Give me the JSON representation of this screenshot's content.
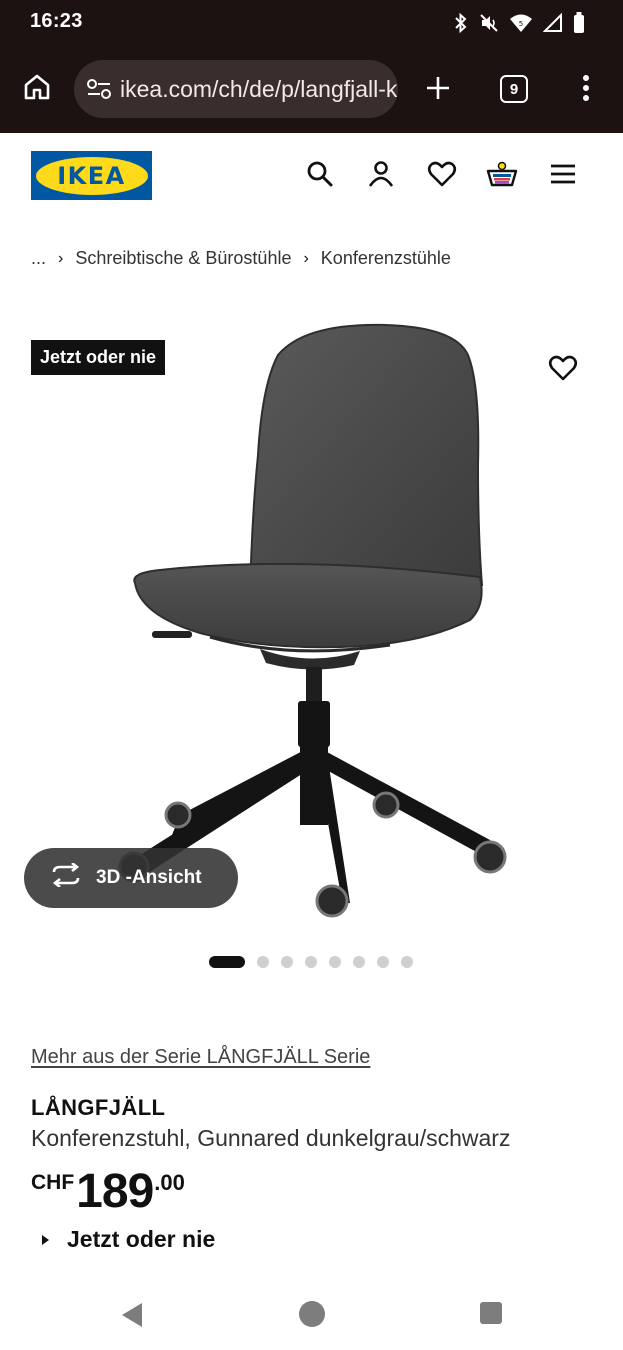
{
  "status_bar": {
    "time": "16:23",
    "icons": [
      "bluetooth-icon",
      "mute-icon",
      "wifi-icon",
      "signal-icon",
      "battery-icon"
    ]
  },
  "browser": {
    "url": "ikea.com/ch/de/p/langfjall-konferenzstuhl",
    "tab_count": "9",
    "icons": [
      "home-icon",
      "site-settings-icon",
      "new-tab-icon",
      "tabs-icon",
      "more-vert-icon"
    ]
  },
  "header": {
    "logo_text": "IKEA",
    "logo_colors": {
      "blue": "#0058a3",
      "yellow": "#ffda1a"
    },
    "icons": [
      "search-icon",
      "account-icon",
      "wishlist-icon",
      "cart-icon",
      "hamburger-menu-icon"
    ]
  },
  "breadcrumb": {
    "ellipsis": "...",
    "items": [
      "Schreibtische & Bürostühle",
      "Konferenzstühle"
    ]
  },
  "gallery": {
    "badge": "Jetzt oder nie",
    "view_3d_label": "3D -Ansicht",
    "slide_count": 8,
    "active_slide": 1,
    "image_alt": "office-chair-product-image"
  },
  "product": {
    "series_link": "Mehr aus der Serie LÅNGFJÄLL Serie",
    "name": "LÅNGFJÄLL",
    "description": "Konferenzstuhl, Gunnared dunkelgrau/schwarz",
    "price": {
      "currency": "CHF",
      "integer": "189",
      "decimals": ".00"
    },
    "offer_label": "Jetzt oder nie"
  },
  "system_nav": {
    "icons": [
      "back-icon",
      "home-circle-icon",
      "recents-icon"
    ]
  }
}
